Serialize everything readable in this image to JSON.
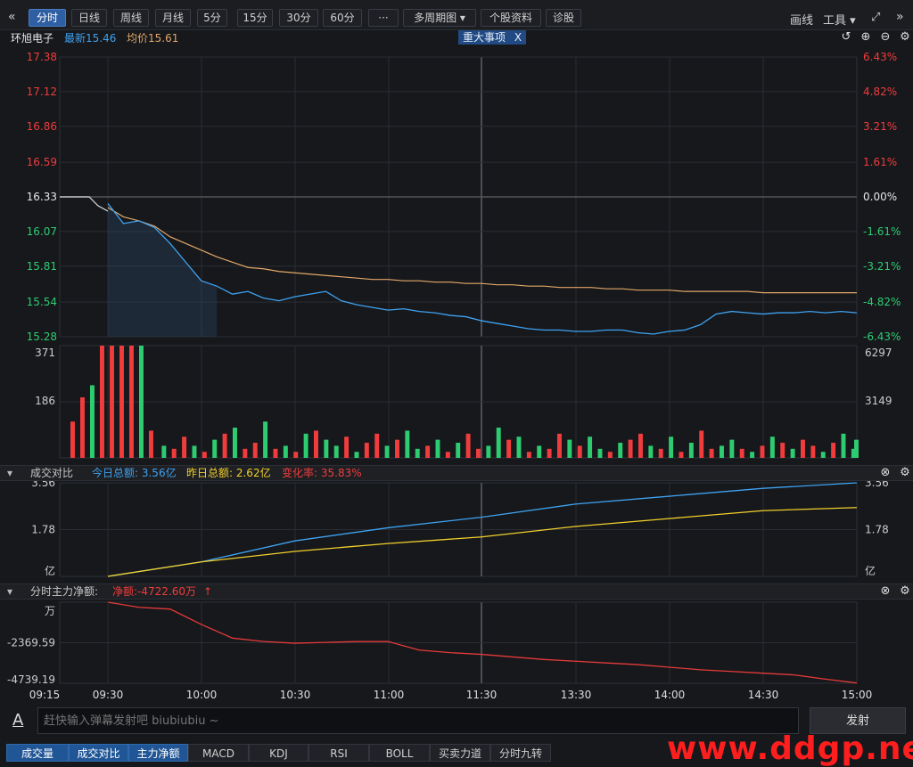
{
  "toolbar": {
    "back_icon": "double-left-chevron",
    "tabs": [
      {
        "label": "分时",
        "active": true
      },
      {
        "label": "日线"
      },
      {
        "label": "周线"
      },
      {
        "label": "月线"
      },
      {
        "label": "5分"
      },
      {
        "label": "15分"
      },
      {
        "label": "30分"
      },
      {
        "label": "60分"
      },
      {
        "label": "···"
      },
      {
        "label": "多周期图 ▾"
      },
      {
        "label": "个股资料"
      },
      {
        "label": "诊股"
      }
    ],
    "draw_label": "画线",
    "tools_label": "工具 ▾"
  },
  "info": {
    "stock_name": "环旭电子",
    "latest_label": "最新15.46",
    "avg_label": "均价15.61",
    "event_label": "重大事项",
    "event_close": "X"
  },
  "colors": {
    "price": "#3fa2f0",
    "avg": "#e2a768",
    "up": "#f03c3c",
    "down": "#2ecc71",
    "turnover_today": "#3fa2f0",
    "turnover_yest": "#f2d02b",
    "flow": "#e63a3a",
    "flat": "#e6e6e6"
  },
  "chart_data": [
    {
      "type": "line",
      "title": "分时",
      "x": [
        "09:30",
        "09:35",
        "09:40",
        "09:45",
        "09:50",
        "09:55",
        "10:00",
        "10:05",
        "10:10",
        "10:15",
        "10:20",
        "10:25",
        "10:30",
        "10:35",
        "10:40",
        "10:45",
        "10:50",
        "10:55",
        "11:00",
        "11:05",
        "11:10",
        "11:15",
        "11:20",
        "11:25",
        "11:30",
        "13:05",
        "13:10",
        "13:15",
        "13:20",
        "13:25",
        "13:30",
        "13:35",
        "13:40",
        "13:45",
        "13:50",
        "13:55",
        "14:00",
        "14:05",
        "14:10",
        "14:15",
        "14:20",
        "14:25",
        "14:30",
        "14:35",
        "14:40",
        "14:45",
        "14:50",
        "14:55",
        "15:00"
      ],
      "series": [
        {
          "name": "最新",
          "values": [
            16.28,
            16.13,
            16.15,
            16.1,
            15.98,
            15.84,
            15.7,
            15.66,
            15.6,
            15.62,
            15.57,
            15.55,
            15.58,
            15.6,
            15.62,
            15.55,
            15.52,
            15.5,
            15.48,
            15.49,
            15.47,
            15.46,
            15.44,
            15.43,
            15.4,
            15.38,
            15.36,
            15.34,
            15.33,
            15.33,
            15.32,
            15.32,
            15.33,
            15.33,
            15.31,
            15.3,
            15.32,
            15.33,
            15.37,
            15.45,
            15.47,
            15.46,
            15.45,
            15.46,
            15.46,
            15.47,
            15.46,
            15.47,
            15.46
          ]
        },
        {
          "name": "均价",
          "values": [
            16.25,
            16.18,
            16.15,
            16.11,
            16.03,
            15.98,
            15.93,
            15.88,
            15.84,
            15.8,
            15.79,
            15.77,
            15.76,
            15.75,
            15.74,
            15.73,
            15.72,
            15.71,
            15.71,
            15.7,
            15.7,
            15.69,
            15.69,
            15.68,
            15.68,
            15.67,
            15.67,
            15.66,
            15.66,
            15.65,
            15.65,
            15.65,
            15.64,
            15.64,
            15.63,
            15.63,
            15.63,
            15.62,
            15.62,
            15.62,
            15.62,
            15.62,
            15.61,
            15.61,
            15.61,
            15.61,
            15.61,
            15.61,
            15.61
          ]
        }
      ],
      "prev_close": 16.33,
      "y_ticks": [
        "17.38",
        "17.12",
        "16.86",
        "16.59",
        "16.33",
        "16.07",
        "15.81",
        "15.54",
        "15.28"
      ],
      "pct_ticks": [
        "6.43%",
        "4.82%",
        "3.21%",
        "1.61%",
        "0.00%",
        "-1.61%",
        "-3.21%",
        "-4.82%",
        "-6.43%"
      ],
      "ylim": [
        15.28,
        17.38
      ]
    },
    {
      "type": "bar",
      "title": "成交量",
      "y_ticks_left": [
        "371",
        "186"
      ],
      "y_ticks_right": [
        "6297",
        "3149"
      ],
      "ylim": [
        0,
        371
      ],
      "values": [
        120,
        200,
        240,
        371,
        371,
        371,
        371,
        371,
        90,
        40,
        30,
        70,
        40,
        20,
        60,
        80,
        100,
        30,
        50,
        120,
        30,
        40,
        20,
        80,
        90,
        60,
        40,
        70,
        20,
        50,
        80,
        40,
        60,
        90,
        30,
        40,
        60,
        20,
        50,
        80,
        30,
        40,
        100,
        60,
        70,
        20,
        40,
        30,
        80,
        60,
        40,
        70,
        30,
        20,
        50,
        60,
        80,
        40,
        30,
        70,
        20,
        50,
        90,
        30,
        40,
        60,
        30,
        20,
        40,
        70,
        50,
        30,
        60,
        40,
        20,
        50,
        80,
        30,
        40,
        60
      ],
      "up": [
        1,
        1,
        0,
        1,
        1,
        1,
        1,
        0,
        1,
        0,
        1,
        1,
        0,
        1,
        0,
        1,
        0,
        1,
        1,
        0,
        1,
        0,
        1,
        0,
        1,
        0,
        0,
        1,
        0,
        1,
        1,
        0,
        1,
        0,
        0,
        1,
        0,
        1,
        0,
        1,
        1,
        0,
        0,
        1,
        0,
        1,
        0,
        1,
        1,
        0,
        1,
        0,
        0,
        1,
        0,
        1,
        1,
        0,
        1,
        0,
        1,
        0,
        1,
        1,
        0,
        0,
        1,
        0,
        1,
        0,
        1,
        0,
        1,
        1,
        0,
        1,
        0,
        0,
        1,
        0
      ]
    },
    {
      "type": "line",
      "title": "成交对比",
      "legend": {
        "today": "今日总额: 3.56亿",
        "yesterday": "昨日总额: 2.62亿",
        "ratio": "变化率: 35.83%"
      },
      "x": [
        "09:30",
        "10:00",
        "10:30",
        "11:00",
        "11:30",
        "13:30",
        "14:00",
        "14:30",
        "15:00"
      ],
      "series": [
        {
          "name": "今日总额",
          "values": [
            0.0,
            0.55,
            1.35,
            1.85,
            2.25,
            2.75,
            3.05,
            3.35,
            3.56
          ]
        },
        {
          "name": "昨日总额",
          "values": [
            0.0,
            0.55,
            0.95,
            1.25,
            1.5,
            1.9,
            2.2,
            2.5,
            2.62
          ]
        }
      ],
      "y_ticks": [
        "3.56",
        "1.78",
        "亿"
      ],
      "ylim": [
        0,
        3.56
      ]
    },
    {
      "type": "line",
      "title": "分时主力净额:",
      "legend": {
        "net": "净额:-4722.60万"
      },
      "x": [
        "09:30",
        "09:40",
        "09:50",
        "10:00",
        "10:10",
        "10:20",
        "10:30",
        "10:40",
        "10:50",
        "11:00",
        "11:10",
        "11:20",
        "11:30",
        "13:10",
        "13:20",
        "13:30",
        "13:40",
        "13:50",
        "14:00",
        "14:10",
        "14:20",
        "14:30",
        "14:40",
        "14:50",
        "15:00"
      ],
      "series": [
        {
          "name": "净额",
          "values": [
            0,
            -300,
            -400,
            -1300,
            -2100,
            -2300,
            -2400,
            -2350,
            -2300,
            -2300,
            -2800,
            -2950,
            -3050,
            -3200,
            -3350,
            -3450,
            -3550,
            -3650,
            -3800,
            -3950,
            -4050,
            -4150,
            -4250,
            -4500,
            -4722
          ]
        }
      ],
      "y_ticks": [
        "万",
        "-2369.59",
        "-4739.19"
      ],
      "ylim": [
        -4739.19,
        0
      ]
    }
  ],
  "x_axis_labels": [
    "09:15",
    "09:30",
    "10:00",
    "10:30",
    "11:00",
    "11:30",
    "13:30",
    "14:00",
    "14:30",
    "15:00"
  ],
  "panels": {
    "turnover_title": "成交对比",
    "flow_title": "分时主力净额:"
  },
  "input": {
    "placeholder": "赶快输入弹幕发射吧 biubiubiu ~",
    "send_label": "发射"
  },
  "bottom_tabs": [
    "成交量",
    "成交对比",
    "主力净额",
    "MACD",
    "KDJ",
    "RSI",
    "BOLL",
    "买卖力道",
    "分时九转"
  ],
  "watermark": "www.ddgp.net"
}
